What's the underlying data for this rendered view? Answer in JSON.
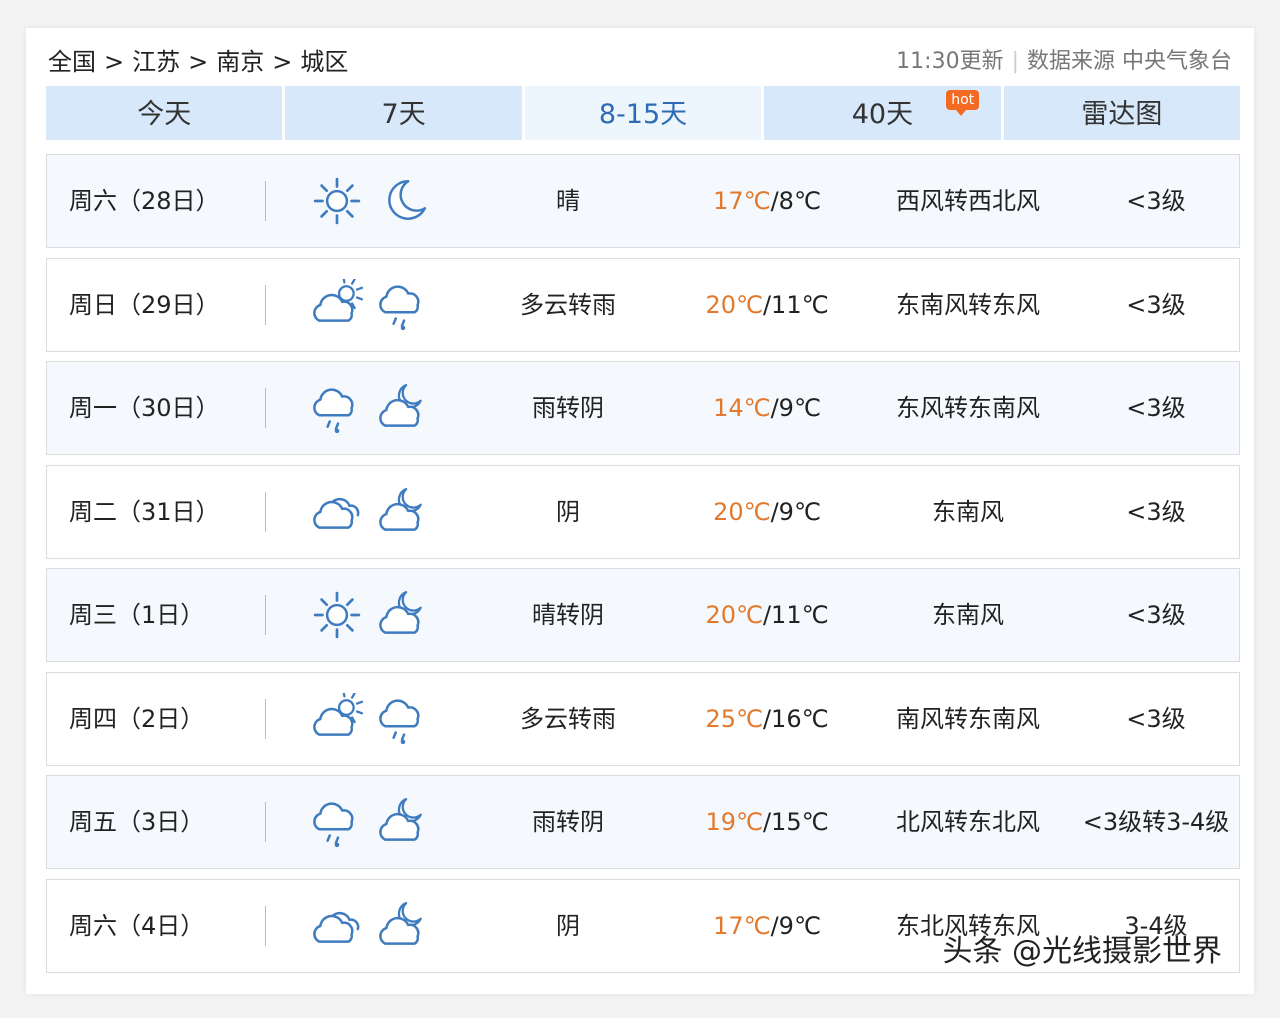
{
  "breadcrumb": {
    "items": [
      "全国",
      "江苏",
      "南京"
    ],
    "separator": ">",
    "current": "城区"
  },
  "meta": {
    "update_time": "11:30更新",
    "source": "数据来源 中央气象台"
  },
  "tabs": [
    {
      "label": "今天",
      "active": false
    },
    {
      "label": "7天",
      "active": false
    },
    {
      "label": "8-15天",
      "active": true
    },
    {
      "label": "40天",
      "active": false,
      "badge": "hot"
    },
    {
      "label": "雷达图",
      "active": false
    }
  ],
  "colors": {
    "accent": "#2d6bb4",
    "tab_bg": "#d6e8f9",
    "temp_high": "#e2792c",
    "hot_badge": "#f36b22",
    "icon_stroke": "#3f7bbf"
  },
  "forecast": [
    {
      "date": "周六（28日）",
      "icon_day": "sunny-icon",
      "icon_night": "moon-icon",
      "desc": "晴",
      "high": "17℃",
      "low": "8℃",
      "wind": "西风转西北风",
      "level": "<3级"
    },
    {
      "date": "周日（29日）",
      "icon_day": "partly-cloudy-day-icon",
      "icon_night": "rain-icon",
      "desc": "多云转雨",
      "high": "20℃",
      "low": "11℃",
      "wind": "东南风转东风",
      "level": "<3级"
    },
    {
      "date": "周一（30日）",
      "icon_day": "rain-icon",
      "icon_night": "partly-cloudy-night-icon",
      "desc": "雨转阴",
      "high": "14℃",
      "low": "9℃",
      "wind": "东风转东南风",
      "level": "<3级"
    },
    {
      "date": "周二（31日）",
      "icon_day": "overcast-icon",
      "icon_night": "partly-cloudy-night-icon",
      "desc": "阴",
      "high": "20℃",
      "low": "9℃",
      "wind": "东南风",
      "level": "<3级"
    },
    {
      "date": "周三（1日）",
      "icon_day": "sunny-icon",
      "icon_night": "partly-cloudy-night-icon",
      "desc": "晴转阴",
      "high": "20℃",
      "low": "11℃",
      "wind": "东南风",
      "level": "<3级"
    },
    {
      "date": "周四（2日）",
      "icon_day": "partly-cloudy-day-icon",
      "icon_night": "rain-icon",
      "desc": "多云转雨",
      "high": "25℃",
      "low": "16℃",
      "wind": "南风转东南风",
      "level": "<3级"
    },
    {
      "date": "周五（3日）",
      "icon_day": "rain-icon",
      "icon_night": "partly-cloudy-night-icon",
      "desc": "雨转阴",
      "high": "19℃",
      "low": "15℃",
      "wind": "北风转东北风",
      "level": "<3级转3-4级"
    },
    {
      "date": "周六（4日）",
      "icon_day": "overcast-icon",
      "icon_night": "partly-cloudy-night-icon",
      "desc": "阴",
      "high": "17℃",
      "low": "9℃",
      "wind": "东北风转东风",
      "level": "3-4级"
    }
  ],
  "watermark": "头条 @光线摄影世界"
}
